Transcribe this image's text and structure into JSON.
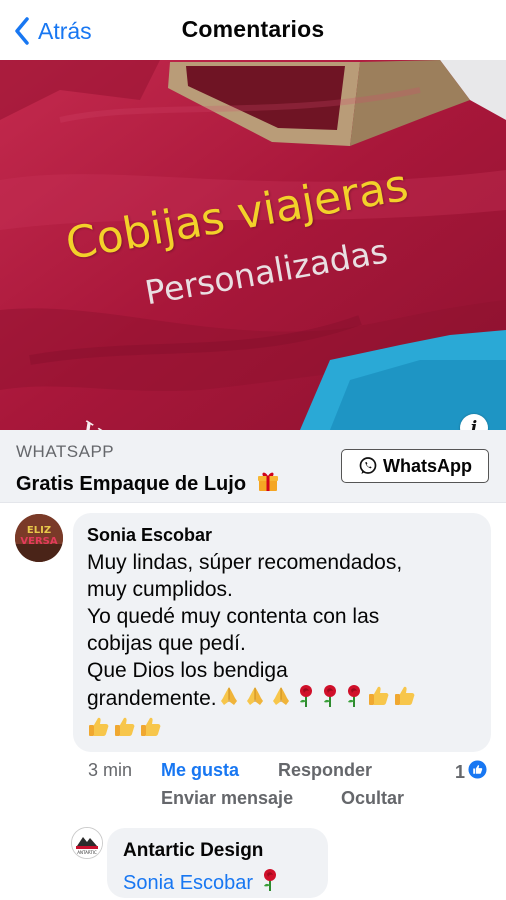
{
  "header": {
    "back_label": "Atrás",
    "title": "Comentarios"
  },
  "ad": {
    "image_headline": "Cobijas viajeras",
    "image_subline": "Personalizadas",
    "image_script": "Yudy",
    "source": "WHATSAPP",
    "headline": "Gratis Empaque de Lujo",
    "headline_icon": "gift-icon",
    "cta_label": "WhatsApp",
    "cta_icon": "whatsapp-icon",
    "info_icon": "i"
  },
  "comment": {
    "author": "Sonia Escobar",
    "lines": [
      "Muy lindas, súper recomendados,",
      "muy cumplidos.",
      "Yo quedé muy contenta con las",
      "cobijas que pedí.",
      "Que Dios los bendiga",
      "grandemente."
    ],
    "emojis_line1": [
      "folded-hands-icon",
      "folded-hands-icon",
      "folded-hands-icon",
      "rose-icon",
      "rose-icon",
      "rose-icon",
      "thumbs-up-icon",
      "thumbs-up-icon"
    ],
    "emojis_line2": [
      "thumbs-up-icon",
      "thumbs-up-icon",
      "thumbs-up-icon"
    ],
    "time": "3 min",
    "like_label": "Me gusta",
    "reply_label": "Responder",
    "send_message_label": "Enviar mensaje",
    "hide_label": "Ocultar",
    "reaction_count": "1",
    "reaction_icon": "like-icon"
  },
  "reply": {
    "author": "Antartic Design",
    "mention": "Sonia Escobar",
    "emoji": "rose-icon"
  },
  "colors": {
    "accent": "#1877f2",
    "bubble": "#f0f2f5",
    "muted_text": "#65676b",
    "blanket": "#b01a3f"
  }
}
